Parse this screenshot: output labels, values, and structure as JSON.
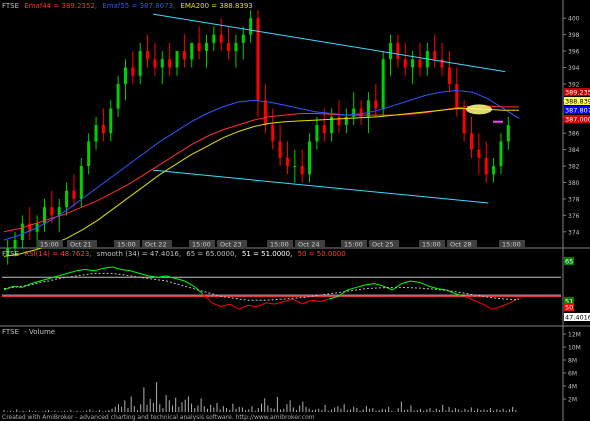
{
  "colors": {
    "background": "#000000",
    "panel_border": "#808080",
    "candle_up": "#00d000",
    "candle_down": "#ff0000",
    "ema44": "#ff3030",
    "ema55": "#3355ff",
    "ema200": "#e0e000",
    "channel": "#40d8ff",
    "rsi_up": "#00ff00",
    "rsi_down": "#ff0000",
    "rsi_smooth": "#c0c0c0",
    "volume": "#b0b0b0",
    "annotation_circle": "#ffff80",
    "annotation_line": "#ff40ff"
  },
  "price_panel": {
    "symbol": "FTSE",
    "ema44_label": "Emaf44 = 389.2352,",
    "ema55_label": "Emaf55 = 387.8073,",
    "ema200_label": "EMA200 = 388.8393",
    "right_tags": [
      {
        "text": "389.235",
        "bg": "#c00000",
        "fg": "#ffffff"
      },
      {
        "text": "388.839",
        "bg": "#ffff60",
        "fg": "#000000"
      },
      {
        "text": "387.807",
        "bg": "#0000ff",
        "fg": "#ffffff"
      },
      {
        "text": "387.000",
        "bg": "#d00000",
        "fg": "#ffffff"
      }
    ],
    "date_labels": [
      {
        "text": "15:00",
        "x": 40
      },
      {
        "text": "Oct 21",
        "x": 70
      },
      {
        "text": "15:00",
        "x": 117
      },
      {
        "text": "Oct 22",
        "x": 145
      },
      {
        "text": "15:00",
        "x": 192
      },
      {
        "text": "Oct 23",
        "x": 220
      },
      {
        "text": "15:00",
        "x": 270
      },
      {
        "text": "Oct 24",
        "x": 298
      },
      {
        "text": "15:00",
        "x": 344
      },
      {
        "text": "Oct 25",
        "x": 372
      },
      {
        "text": "15:00",
        "x": 422
      },
      {
        "text": "Oct 28",
        "x": 450
      },
      {
        "text": "15:00",
        "x": 502
      }
    ]
  },
  "rsi_panel": {
    "symbol": "FTSE",
    "rsi_label": "RSI(14) = 48.7623,",
    "smooth_label": "smooth (34) = 47.4016,",
    "level65_label": "65 = 65.0000,",
    "level51_label": "51 = 51.0000,",
    "level50_label": "50 = 50.0000",
    "right_tags": [
      {
        "text": "65",
        "bg": "#008000",
        "fg": "#ffffff",
        "value": 65
      },
      {
        "text": "51",
        "bg": "#008000",
        "fg": "#ffffff",
        "value": 51
      },
      {
        "text": "50",
        "bg": "#ff0000",
        "fg": "#ffffff",
        "value": 50
      },
      {
        "text": "47.4016",
        "bg": "#ffffff",
        "fg": "#000000",
        "value": 47.4
      }
    ]
  },
  "volume_panel": {
    "symbol": "FTSE",
    "label": "Volume"
  },
  "footer": "Created with AmiBroker - advanced charting and technical analysis software. http://www.amibroker.com",
  "chart_data": [
    {
      "type": "candlestick",
      "series": [
        {
          "name": "FTSE",
          "values": [
            [
              371,
              373,
              370,
              372
            ],
            [
              372,
              374,
              371,
              373
            ],
            [
              373,
              376,
              372,
              375
            ],
            [
              375,
              377,
              373,
              374
            ],
            [
              374,
              376,
              372,
              375
            ],
            [
              375,
              378,
              374,
              377
            ],
            [
              377,
              379,
              375,
              376
            ],
            [
              376,
              378,
              374,
              377
            ],
            [
              377,
              380,
              376,
              379
            ],
            [
              379,
              381,
              377,
              378
            ],
            [
              378,
              383,
              377,
              382
            ],
            [
              382,
              386,
              381,
              385
            ],
            [
              385,
              388,
              384,
              387
            ],
            [
              387,
              389,
              385,
              386
            ],
            [
              386,
              390,
              385,
              389
            ],
            [
              389,
              393,
              388,
              392
            ],
            [
              392,
              395,
              390,
              394
            ],
            [
              394,
              396,
              392,
              393
            ],
            [
              393,
              397,
              392,
              396
            ],
            [
              396,
              398,
              394,
              395
            ],
            [
              395,
              397,
              393,
              394
            ],
            [
              394,
              396,
              392,
              395
            ],
            [
              395,
              397,
              393,
              394
            ],
            [
              394,
              396,
              393,
              396
            ],
            [
              396,
              398,
              394,
              395
            ],
            [
              395,
              397,
              394,
              397
            ],
            [
              397,
              399,
              395,
              396
            ],
            [
              396,
              398,
              394,
              397
            ],
            [
              397,
              399,
              396,
              398
            ],
            [
              398,
              400,
              396,
              397
            ],
            [
              397,
              399,
              395,
              396
            ],
            [
              396,
              398,
              394,
              397
            ],
            [
              397,
              399,
              395,
              398
            ],
            [
              398,
              401,
              397,
              400
            ],
            [
              400,
              401,
              388,
              390
            ],
            [
              390,
              392,
              386,
              387
            ],
            [
              387,
              389,
              384,
              385
            ],
            [
              385,
              387,
              382,
              383
            ],
            [
              383,
              385,
              381,
              382
            ],
            [
              382,
              384,
              380,
              382
            ],
            [
              382,
              384,
              380,
              381
            ],
            [
              381,
              386,
              380,
              385
            ],
            [
              385,
              388,
              384,
              387
            ],
            [
              387,
              389,
              385,
              386
            ],
            [
              386,
              389,
              385,
              388
            ],
            [
              388,
              390,
              386,
              387
            ],
            [
              387,
              389,
              386,
              388
            ],
            [
              388,
              391,
              387,
              389
            ],
            [
              389,
              390,
              387,
              388
            ],
            [
              388,
              391,
              386,
              390
            ],
            [
              390,
              392,
              388,
              389
            ],
            [
              389,
              396,
              388,
              395
            ],
            [
              395,
              398,
              393,
              397
            ],
            [
              397,
              398,
              394,
              395
            ],
            [
              395,
              397,
              393,
              394
            ],
            [
              394,
              396,
              392,
              395
            ],
            [
              395,
              397,
              393,
              394
            ],
            [
              394,
              397,
              393,
              396
            ],
            [
              396,
              398,
              394,
              395
            ],
            [
              395,
              397,
              393,
              394
            ],
            [
              394,
              396,
              391,
              392
            ],
            [
              392,
              394,
              388,
              389
            ],
            [
              389,
              390,
              385,
              386
            ],
            [
              386,
              388,
              383,
              384
            ],
            [
              384,
              386,
              381,
              383
            ],
            [
              383,
              385,
              380,
              381
            ],
            [
              381,
              383,
              380,
              382
            ],
            [
              382,
              386,
              381,
              385
            ],
            [
              385,
              388,
              384,
              387
            ]
          ]
        },
        {
          "name": "Emaf44",
          "values": [
            374,
            374.4,
            375,
            375.6,
            376.2,
            377,
            377.8,
            378.8,
            379.8,
            381,
            382.2,
            383.4,
            384.6,
            385.6,
            386.4,
            387,
            387.6,
            388,
            388.2,
            388.4,
            388.4,
            388.3,
            388.2,
            388.2,
            388.2,
            388.2,
            388.3,
            388.5,
            388.8,
            389.1,
            389.3,
            389.3,
            389.2,
            389.2
          ]
        },
        {
          "name": "Emaf55",
          "values": [
            373,
            373.6,
            374.4,
            375.4,
            376.6,
            378,
            379.4,
            380.8,
            382.2,
            383.6,
            385,
            386.2,
            387.4,
            388.4,
            389.2,
            389.8,
            390,
            389.8,
            389.4,
            389,
            388.6,
            388.4,
            388.2,
            388.4,
            388.8,
            389.4,
            390,
            390.6,
            391,
            391.2,
            391,
            390.2,
            389,
            387.8
          ]
        },
        {
          "name": "EMA200",
          "values": [
            371,
            371.3,
            371.8,
            372.4,
            373.2,
            374.2,
            375.4,
            376.8,
            378.2,
            379.6,
            381,
            382.2,
            383.4,
            384.4,
            385.4,
            386.2,
            386.8,
            387.2,
            387.4,
            387.5,
            387.6,
            387.7,
            387.8,
            387.9,
            388,
            388.2,
            388.4,
            388.6,
            388.8,
            389,
            389,
            388.9,
            388.8,
            388.8
          ]
        }
      ],
      "ylim": [
        373,
        401
      ],
      "y_ticks": [
        374,
        376,
        378,
        380,
        382,
        384,
        386,
        388,
        390,
        392,
        394,
        396,
        398,
        400
      ],
      "channel_upper": [
        [
          0.27,
          400.5
        ],
        [
          0.9,
          393.5
        ]
      ],
      "channel_lower": [
        [
          0.27,
          381.5
        ],
        [
          0.87,
          377.5
        ]
      ]
    },
    {
      "type": "line",
      "series": [
        {
          "name": "RSI(14)",
          "values": [
            55,
            58,
            57,
            60,
            62,
            64,
            66,
            68,
            70,
            71,
            70,
            72,
            73,
            71,
            70,
            68,
            66,
            65,
            66,
            64,
            62,
            58,
            52,
            45,
            42,
            44,
            40,
            43,
            42,
            45,
            44,
            46,
            48,
            44,
            47,
            46,
            48,
            50,
            55,
            57,
            59,
            60,
            58,
            55,
            60,
            62,
            61,
            58,
            56,
            55,
            52,
            50,
            47,
            44,
            40,
            42,
            45,
            48.8
          ]
        },
        {
          "name": "smooth (34)",
          "values": [
            56,
            57,
            58,
            59,
            61,
            62,
            64,
            65,
            66,
            67,
            68,
            68,
            68,
            67,
            66,
            65,
            64,
            63,
            62,
            60,
            58,
            56,
            54,
            52,
            50,
            49,
            48,
            47,
            47,
            47,
            47.5,
            48,
            48.5,
            49,
            50,
            51,
            52,
            53,
            54,
            55,
            56,
            56.5,
            56.8,
            57,
            57,
            56.8,
            56.5,
            56,
            55.4,
            54.6,
            53.6,
            52.4,
            51.2,
            50,
            49,
            48.2,
            47.6,
            47.4
          ]
        }
      ],
      "levels": [
        65,
        51,
        50
      ],
      "ylim": [
        30,
        80
      ]
    },
    {
      "type": "bar",
      "series": [
        {
          "name": "Volume",
          "values": [
            0.3,
            0.1,
            0.2,
            0.1,
            0.4,
            0.1,
            0.2,
            0.1,
            0.3,
            0.1,
            0.2,
            0.1,
            0.1,
            0.2,
            0.3,
            0.1,
            0.2,
            0.1,
            0.1,
            0.2,
            0.1,
            0.3,
            0.1,
            0.2,
            0.1,
            0.1,
            0.2,
            0.4,
            0.2,
            0.1,
            0.3,
            0.1,
            0.2,
            0.3,
            0.5,
            0.8,
            1.2,
            0.8,
            1.8,
            0.6,
            2.4,
            0.9,
            0.3,
            1.2,
            3.8,
            1.1,
            2.0,
            1.4,
            4.6,
            1.2,
            0.6,
            2.6,
            1.8,
            1.0,
            2.2,
            0.8,
            1.5,
            1.9,
            2.4,
            1.3,
            0.6,
            1.0,
            2.1,
            0.9,
            0.5,
            1.1,
            0.7,
            1.4,
            0.4,
            0.9,
            0.6,
            0.3,
            1.3,
            0.5,
            0.8,
            0.7,
            0.3,
            0.4,
            0.9,
            0.2,
            0.6,
            1.3,
            2.1,
            1.0,
            0.6,
            0.5,
            2.3,
            0.4,
            0.5,
            1.2,
            1.8,
            0.7,
            0.3,
            1.0,
            1.6,
            0.8,
            0.5,
            0.3,
            0.4,
            0.5,
            0.3,
            1.1,
            0.2,
            0.4,
            0.7,
            0.9,
            0.5,
            1.2,
            0.3,
            0.4,
            0.8,
            0.6,
            0.2,
            0.4,
            0.9,
            0.5,
            0.6,
            0.2,
            0.3,
            0.5,
            0.4,
            0.8,
            0.2,
            0.1,
            0.6,
            1.6,
            0.3,
            0.4,
            1.0,
            0.2,
            0.3,
            0.5,
            0.2,
            0.4,
            0.6,
            0.2,
            0.5,
            0.3,
            1.1,
            0.2,
            0.8,
            0.3,
            0.6,
            0.4,
            0.2,
            0.5,
            0.3,
            0.7,
            0.2,
            0.5,
            0.3,
            0.4,
            0.3,
            0.6,
            0.2,
            0.4,
            0.3,
            0.5,
            0.2,
            0.4,
            0.8,
            0.3
          ]
        }
      ],
      "ylim": [
        0,
        12
      ],
      "y_ticks": [
        2,
        4,
        6,
        8,
        10,
        12
      ],
      "y_tick_labels": [
        "2M",
        "4M",
        "6M",
        "8M",
        "10M",
        "12M"
      ]
    }
  ]
}
